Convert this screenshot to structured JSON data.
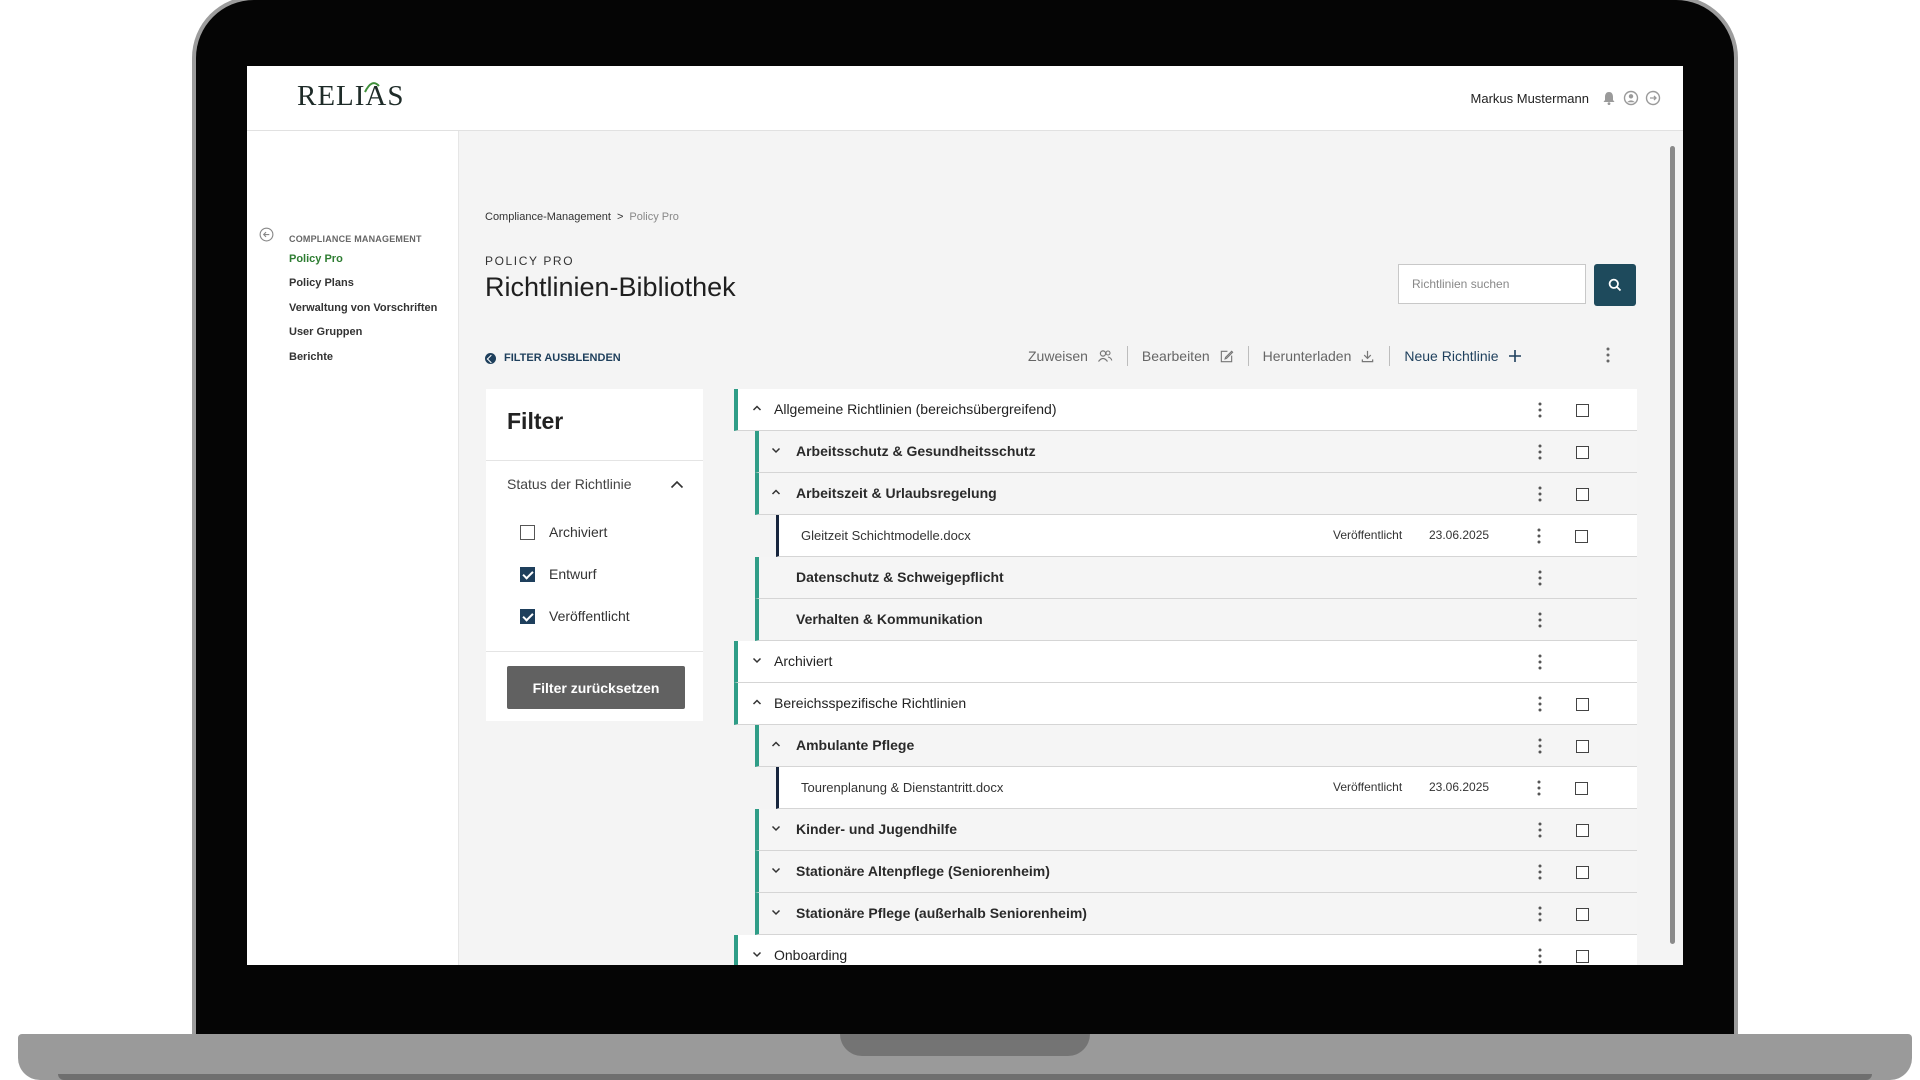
{
  "header": {
    "logo_text": "RELIAS",
    "user_name": "Markus Mustermann"
  },
  "sidebar": {
    "section_label": "COMPLIANCE MANAGEMENT",
    "items": [
      {
        "label": "Policy Pro",
        "active": true
      },
      {
        "label": "Policy Plans"
      },
      {
        "label": "Verwaltung von Vorschriften"
      },
      {
        "label": "User Gruppen"
      },
      {
        "label": "Berichte"
      }
    ]
  },
  "breadcrumb": {
    "parent": "Compliance-Management",
    "separator": ">",
    "current": "Policy Pro"
  },
  "page": {
    "eyebrow": "POLICY PRO",
    "title": "Richtlinien-Bibliothek"
  },
  "search": {
    "placeholder": "Richtlinien suchen"
  },
  "filter_toggle_label": "FILTER AUSBLENDEN",
  "toolbar": {
    "assign": "Zuweisen",
    "edit": "Bearbeiten",
    "download": "Herunterladen",
    "new_policy": "Neue Richtlinie"
  },
  "filter": {
    "title": "Filter",
    "status_heading": "Status der Richtlinie",
    "options": [
      {
        "label": "Archiviert",
        "checked": false
      },
      {
        "label": "Entwurf",
        "checked": true
      },
      {
        "label": "Veröffentlicht",
        "checked": true
      }
    ],
    "reset_label": "Filter zurücksetzen"
  },
  "tree": [
    {
      "label": "Allgemeine Richtlinien (bereichsübergreifend)",
      "level": 0,
      "expanded": true,
      "checkbox": true
    },
    {
      "label": "Arbeitsschutz & Gesundheitsschutz",
      "level": 1,
      "expanded": false,
      "checkbox": true
    },
    {
      "label": "Arbeitszeit & Urlaubsregelung",
      "level": 1,
      "expanded": true,
      "checkbox": true
    },
    {
      "label": "Gleitzeit Schichtmodelle.docx",
      "level": 2,
      "status": "Veröffentlicht",
      "date": "23.06.2025",
      "checkbox": true
    },
    {
      "label": "Datenschutz & Schweigepflicht",
      "level": 1,
      "chevron": false,
      "checkbox": false
    },
    {
      "label": "Verhalten & Kommunikation",
      "level": 1,
      "chevron": false,
      "checkbox": false
    },
    {
      "label": "Archiviert",
      "level": 0,
      "expanded": false,
      "checkbox": false
    },
    {
      "label": "Bereichsspezifische Richtlinien",
      "level": 0,
      "expanded": true,
      "checkbox": true
    },
    {
      "label": "Ambulante Pflege",
      "level": 1,
      "expanded": true,
      "checkbox": true
    },
    {
      "label": "Tourenplanung & Dienstantritt.docx",
      "level": 2,
      "status": "Veröffentlicht",
      "date": "23.06.2025",
      "checkbox": true
    },
    {
      "label": "Kinder- und Jugendhilfe",
      "level": 1,
      "expanded": false,
      "checkbox": true
    },
    {
      "label": "Stationäre Altenpflege (Seniorenheim)",
      "level": 1,
      "expanded": false,
      "checkbox": true
    },
    {
      "label": "Stationäre Pflege (außerhalb Seniorenheim)",
      "level": 1,
      "expanded": false,
      "checkbox": true
    },
    {
      "label": "Onboarding",
      "level": 0,
      "expanded": false,
      "checkbox": true
    }
  ],
  "colors": {
    "accent_green": "#2e7d32",
    "tree_bar": "#2f9d87",
    "navy": "#1e3f5c",
    "search_button": "#1e4a5c",
    "reset_button": "#616161"
  }
}
